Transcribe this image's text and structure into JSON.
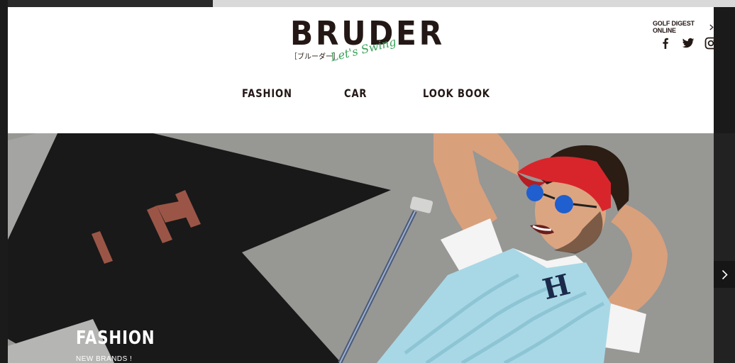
{
  "brand": {
    "name": "BRUDER",
    "kana": "［ブルーダー］",
    "tagline": "Let's Swing"
  },
  "header": {
    "external_link": "GOLF DIGEST ONLINE",
    "social": [
      "facebook-icon",
      "twitter-icon",
      "instagram-icon"
    ]
  },
  "nav": {
    "items": [
      {
        "label": "FASHION"
      },
      {
        "label": "CAR"
      },
      {
        "label": "LOOK BOOK"
      }
    ]
  },
  "hero": {
    "court_letters": "IN",
    "chest_letter": "H",
    "title": "FASHION",
    "subtitle": "NEW BRANDS !"
  },
  "colors": {
    "ink": "#231815",
    "accent_green": "#3aa15a",
    "header_bg": "#ffffff"
  }
}
